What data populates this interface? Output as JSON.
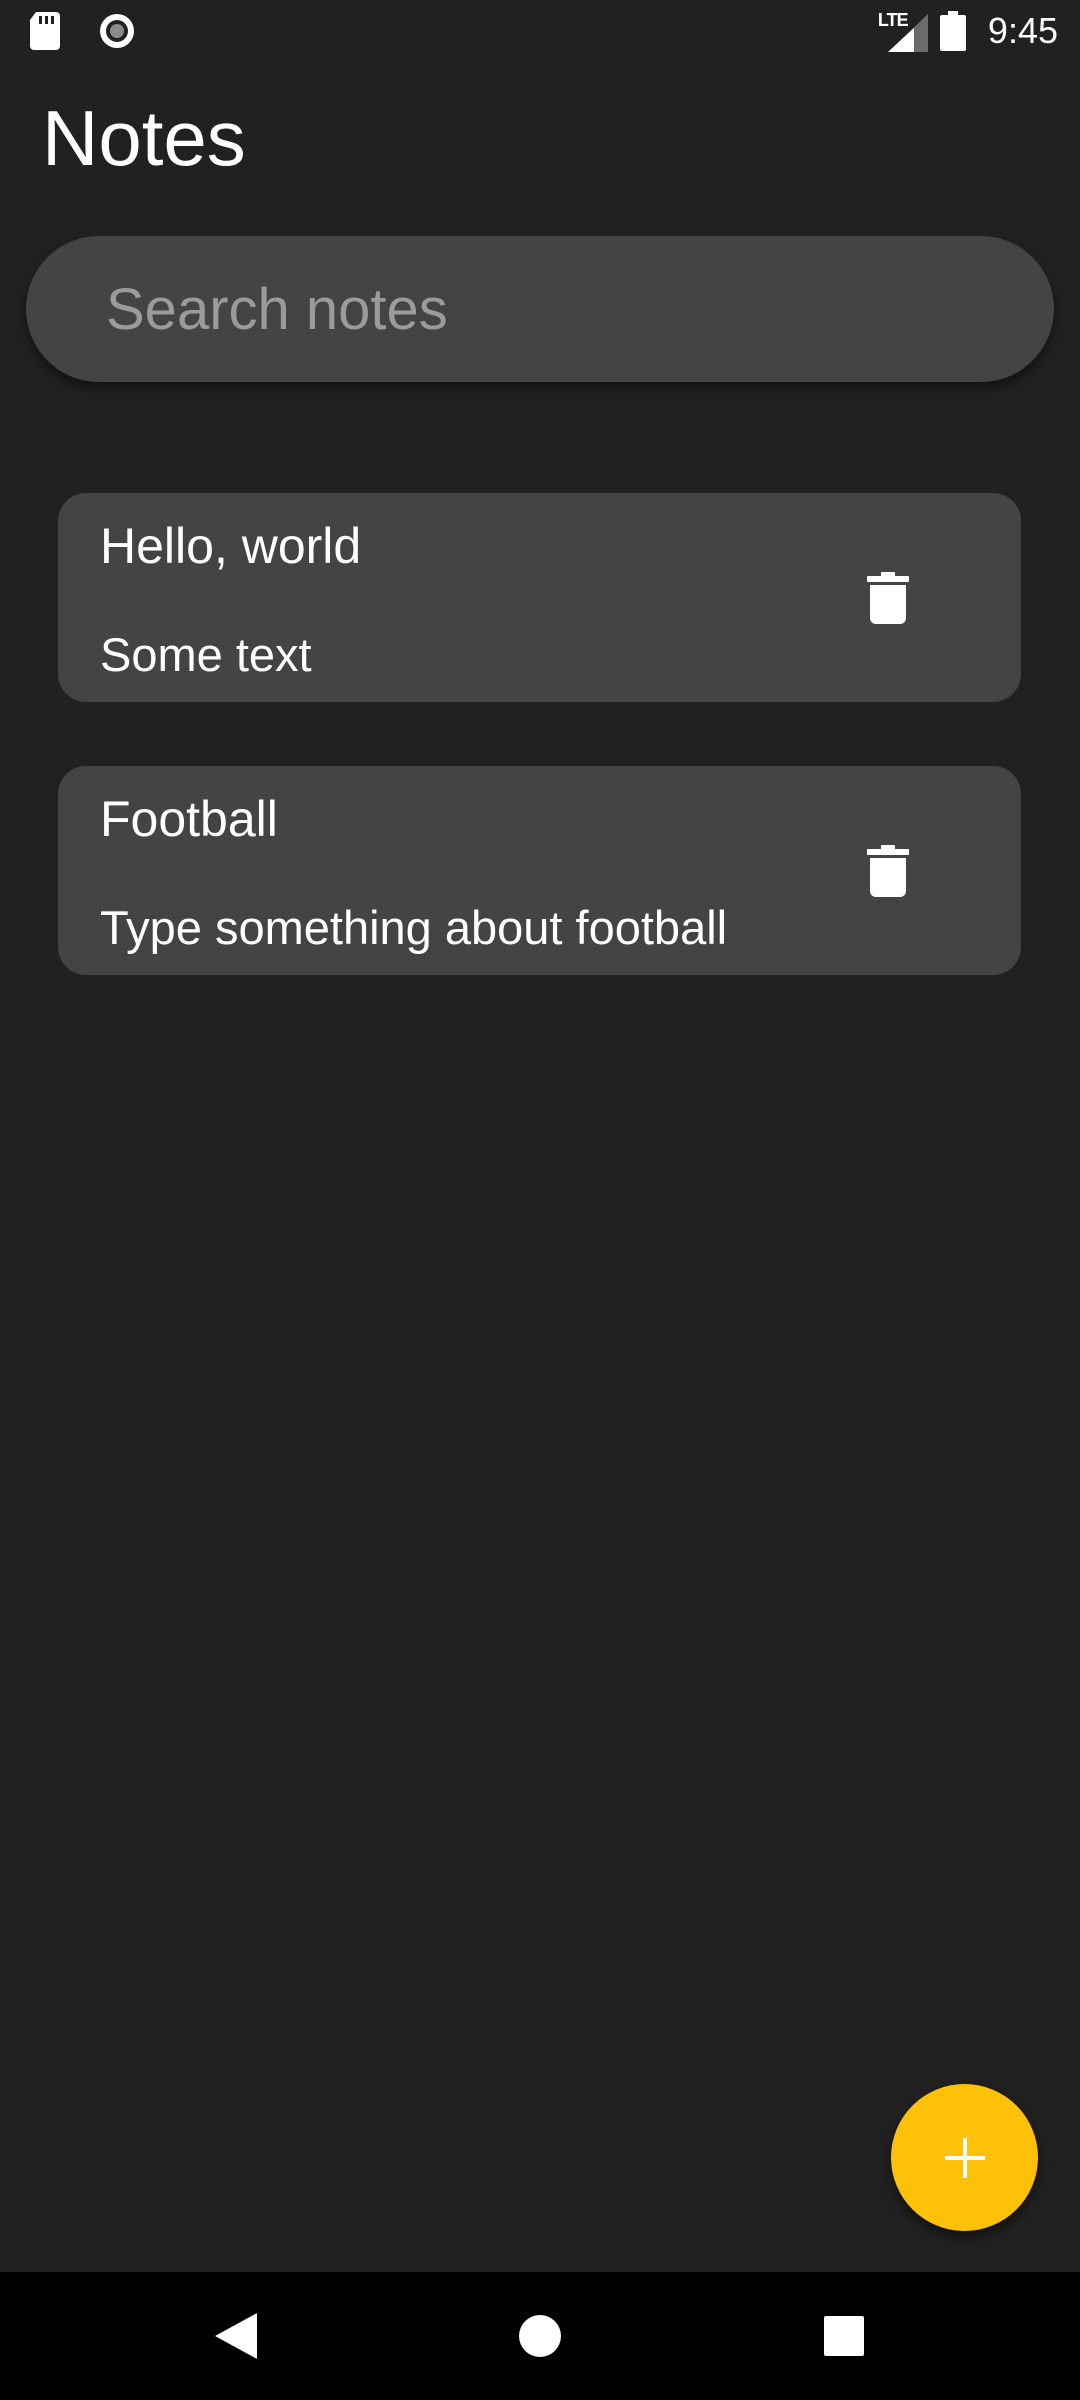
{
  "status_bar": {
    "network_type": "LTE",
    "time": "9:45",
    "icons": [
      "sd-card-icon",
      "recording-icon",
      "signal-icon",
      "battery-icon"
    ]
  },
  "header": {
    "title": "Notes"
  },
  "search": {
    "placeholder": "Search notes",
    "value": ""
  },
  "notes": [
    {
      "title": "Hello, world",
      "body": "Some text"
    },
    {
      "title": "Football",
      "body": "Type something about football"
    }
  ],
  "fab": {
    "icon": "plus-icon",
    "color": "#FFC107"
  },
  "nav_bar": {
    "icons": [
      "back-icon",
      "home-icon",
      "recents-icon"
    ]
  },
  "colors": {
    "background": "#212121",
    "card": "#444444",
    "accent": "#FFC107"
  }
}
